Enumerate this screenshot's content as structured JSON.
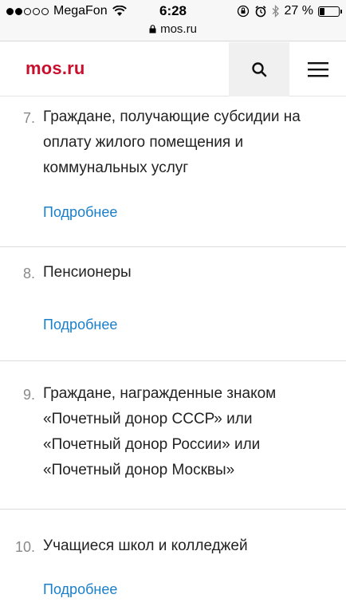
{
  "status_bar": {
    "carrier": "MegaFon",
    "time": "6:28",
    "battery": "27 %",
    "battery_level": 0.27,
    "signal_bars": 2,
    "icons": [
      "wifi-icon",
      "orientation-lock-icon",
      "alarm-icon",
      "bluetooth-icon",
      "battery-icon"
    ]
  },
  "url_bar": {
    "url": "mos.ru"
  },
  "header": {
    "logo": "mos.ru",
    "search_icon": "search-icon",
    "menu_icon": "hamburger-menu-icon",
    "logo_color": "#c8102e"
  },
  "items": [
    {
      "number": "7.",
      "title": "Граждане, получающие субсидии на оплату жилого помещения и коммунальных услуг",
      "link": "Подробнее"
    },
    {
      "number": "8.",
      "title": "Пенсионеры",
      "link": "Подробнее"
    },
    {
      "number": "9.",
      "title": "Граждане, награжденные знаком «Почетный донор СССР» или «Почетный донор России» или «Почетный донор Москвы»",
      "link": ""
    },
    {
      "number": "10.",
      "title": "Учащиеся школ и колледжей",
      "link": "Подробнее"
    }
  ],
  "link_color": "#1a7fc9"
}
